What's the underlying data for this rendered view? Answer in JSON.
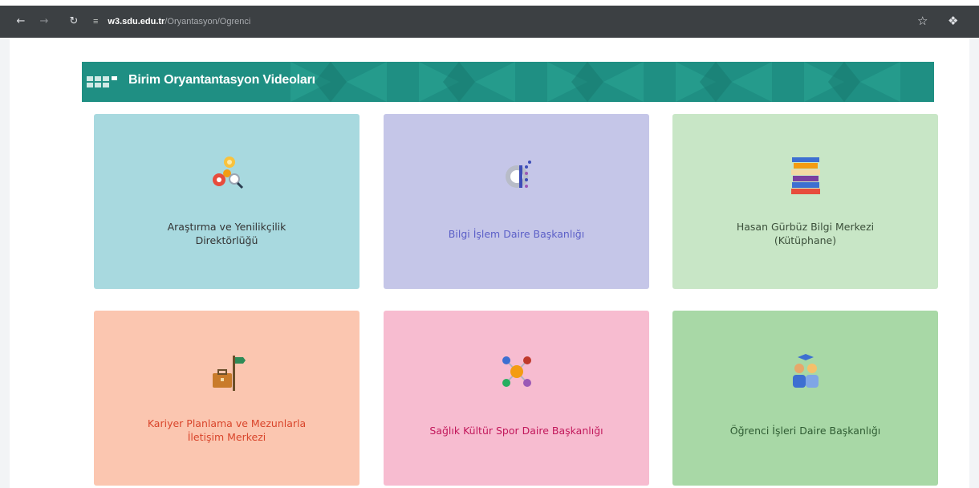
{
  "browser": {
    "back_icon": "arrow-left-icon",
    "forward_icon": "arrow-right-icon",
    "reload_icon": "reload-icon",
    "url_host": "w3.sdu.edu.tr",
    "url_path": "/Oryantasyon/Ogrenci",
    "bookmark_icon": "star-icon",
    "extensions_icon": "puzzle-icon"
  },
  "header": {
    "title": "Birim Oryantantasyon Videoları",
    "color": "#1f8f83"
  },
  "cards": [
    {
      "label_lines": [
        "Araştırma ve Yenilikçilik",
        "Direktörlüğü"
      ],
      "icon": "gears-search-icon",
      "color": "#a8d9df"
    },
    {
      "label_lines": [
        "Bilgi İşlem Daire Başkanlığı"
      ],
      "icon": "tech-gear-icon",
      "color": "#c5c6e8"
    },
    {
      "label_lines": [
        "Hasan Gürbüz Bilgi Merkezi",
        "(Kütüphane)"
      ],
      "icon": "books-icon",
      "color": "#c8e6c6"
    },
    {
      "label_lines": [
        "Kariyer Planlama ve Mezunlarla",
        "İletişim Merkezi"
      ],
      "icon": "briefcase-signpost-icon",
      "color": "#fbc6b0"
    },
    {
      "label_lines": [
        "Sağlık Kültür Spor Daire Başkanlığı"
      ],
      "icon": "network-icon",
      "color": "#f7bcd0"
    },
    {
      "label_lines": [
        "Öğrenci İşleri Daire Başkanlığı"
      ],
      "icon": "students-icon",
      "color": "#a8d8a6"
    }
  ]
}
